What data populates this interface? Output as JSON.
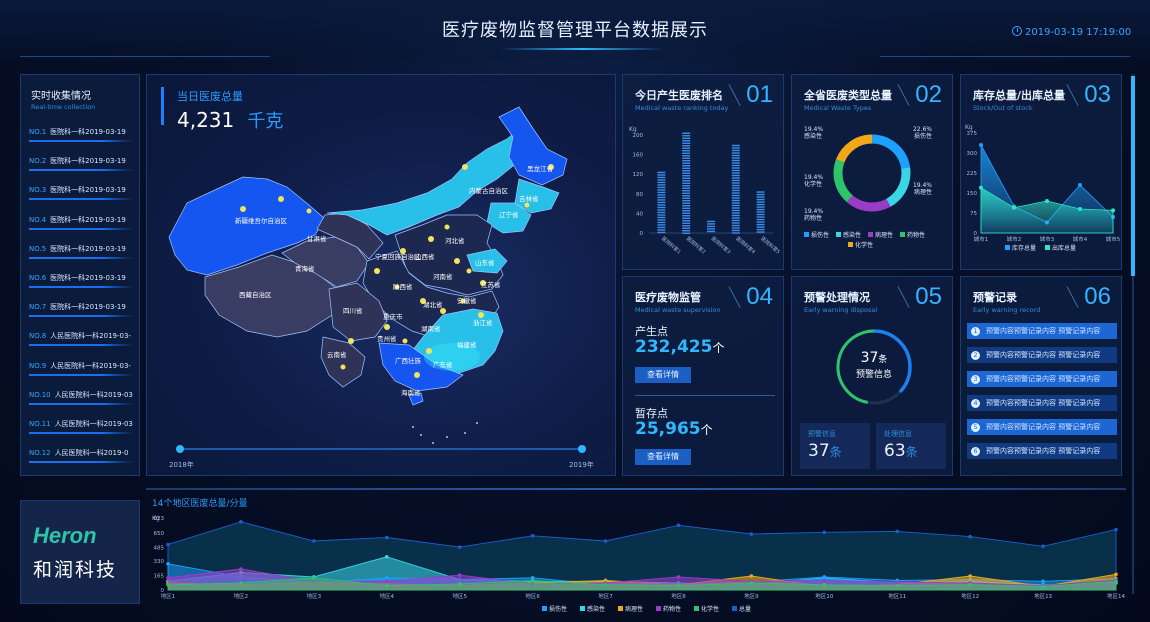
{
  "header": {
    "title": "医疗废物监督管理平台数据展示",
    "datetime": "2019-03-19 17:19:00",
    "clock_icon": "clock-icon"
  },
  "left": {
    "title": "实时收集情况",
    "subtitle": "Real-time collection",
    "items": [
      {
        "no": "NO.1",
        "text": "医院科一科2019-03-19"
      },
      {
        "no": "NO.2",
        "text": "医院科一科2019-03-19"
      },
      {
        "no": "NO.3",
        "text": "医院科一科2019-03-19"
      },
      {
        "no": "NO.4",
        "text": "医院科一科2019-03-19"
      },
      {
        "no": "NO.5",
        "text": "医院科一科2019-03-19"
      },
      {
        "no": "NO.6",
        "text": "医院科一科2019-03-19"
      },
      {
        "no": "NO.7",
        "text": "医院科一科2019-03-19"
      },
      {
        "no": "NO.8",
        "text": "人民医院科一科2019-03-"
      },
      {
        "no": "NO.9",
        "text": "人民医院科一科2019-03-"
      },
      {
        "no": "NO.10",
        "text": "人民医院科一科2019-03"
      },
      {
        "no": "NO.11",
        "text": "人民医院科一科2019-03"
      },
      {
        "no": "NO.12",
        "text": "人民医院科一科2019-0"
      }
    ]
  },
  "map": {
    "title": "当日医废总量",
    "total": "4,231",
    "unit": "千克",
    "timeline_start": "2018年",
    "timeline_end": "2019年",
    "provinces": [
      "黑龙江省",
      "吉林省",
      "辽宁省",
      "内蒙古自治区",
      "新疆维吾尔自治区",
      "甘肃省",
      "青海省",
      "西藏自治区",
      "四川省",
      "云南省",
      "贵州省",
      "广西壮族",
      "广东省",
      "湖南省",
      "湖北省",
      "重庆市",
      "陕西省",
      "宁夏回族自治区",
      "山西省",
      "河北省",
      "山东省",
      "河南省",
      "安徽省",
      "江苏省",
      "浙江省",
      "福建省",
      "海南省"
    ]
  },
  "panels": {
    "p1": {
      "title": "今日产生医废排名",
      "subtitle": "Medical waste ranking today",
      "num": "01"
    },
    "p2": {
      "title": "全省医废类型总量",
      "subtitle": "Medical Waste Types",
      "num": "02"
    },
    "p3": {
      "title": "库存总量/出库总量",
      "subtitle": "Stock/Out of stock",
      "num": "03"
    },
    "p4": {
      "title": "医疗废物监管",
      "subtitle": "Medical waste supervision",
      "num": "04",
      "produce_label": "产生点",
      "produce_value": "232,425",
      "produce_unit": "个",
      "produce_btn": "查看详情",
      "store_label": "暂存点",
      "store_value": "25,965",
      "store_unit": "个",
      "store_btn": "查看详情"
    },
    "p5": {
      "title": "预警处理情况",
      "subtitle": "Early warning disposal",
      "num": "05",
      "ring_value": "37",
      "ring_unit": "条",
      "ring_label": "预警信息",
      "left_label": "预警信息",
      "left_value": "37",
      "left_unit": "条",
      "right_label": "处理信息",
      "right_value": "63",
      "right_unit": "条"
    },
    "p6": {
      "title": "预警记录",
      "subtitle": "Early warning record",
      "num": "06",
      "rows": [
        {
          "n": "1",
          "text": "预警内容预警记录内容 预警记录内容"
        },
        {
          "n": "2",
          "text": "预警内容预警记录内容 预警记录内容"
        },
        {
          "n": "3",
          "text": "预警内容预警记录内容 预警记录内容"
        },
        {
          "n": "4",
          "text": "预警内容预警记录内容 预警记录内容"
        },
        {
          "n": "5",
          "text": "预警内容预警记录内容 预警记录内容"
        },
        {
          "n": "6",
          "text": "预警内容预警记录内容 预警记录内容"
        }
      ]
    }
  },
  "brand": {
    "logo_text": "Heron",
    "name": "和润科技"
  },
  "bottom": {
    "title": "14个地区医废总量/分量"
  },
  "colors": {
    "accent": "#33b5ff",
    "panel": "#0d1e42",
    "border": "#1a3a70"
  },
  "chart_data": [
    {
      "type": "bar",
      "ylabel": "Kg",
      "ylim": [
        0,
        200
      ],
      "yticks": [
        0,
        40,
        80,
        120,
        160,
        200
      ],
      "categories": [
        "医院科室1",
        "医院科室2",
        "医院科室3",
        "医院科室4",
        "医院科室5"
      ],
      "values": [
        125,
        205,
        25,
        180,
        85
      ]
    },
    {
      "type": "pie",
      "style": "donut",
      "labels": [
        "感染性",
        "损伤性",
        "病理性",
        "药物性",
        "化学性"
      ],
      "values": [
        22.6,
        19.4,
        19.4,
        19.4,
        19.4
      ],
      "label_text": [
        "22.6% 损伤性",
        "19.4% 感染性",
        "19.4% 病理性",
        "19.4% 药物性",
        "19.4% 化学性"
      ],
      "legend": [
        "损伤性",
        "感染性",
        "病理性",
        "药物性",
        "化学性"
      ],
      "colors": [
        "#1ea0ff",
        "#3ad6e6",
        "#9a3cc8",
        "#2ec46a",
        "#f0a818"
      ]
    },
    {
      "type": "area",
      "ylabel": "Kg",
      "ylim": [
        0,
        375
      ],
      "yticks": [
        0,
        75,
        150,
        225,
        300,
        375
      ],
      "categories": [
        "城市1",
        "城市2",
        "城市3",
        "城市4",
        "城市5"
      ],
      "series": [
        {
          "name": "库存总量",
          "values": [
            330,
            100,
            40,
            180,
            60
          ]
        },
        {
          "name": "出库总量",
          "values": [
            170,
            95,
            120,
            90,
            85
          ]
        }
      ]
    },
    {
      "type": "area",
      "title": "14个地区医废总量/分量",
      "ylabel": "Kg",
      "ylim": [
        0,
        823
      ],
      "yticks": [
        0,
        165,
        330,
        485,
        650,
        823
      ],
      "categories": [
        "地区1",
        "地区2",
        "地区3",
        "地区4",
        "地区5",
        "地区6",
        "地区7",
        "地区8",
        "地区9",
        "地区10",
        "地区11",
        "地区12",
        "地区13",
        "地区14"
      ],
      "series": [
        {
          "name": "损伤性",
          "values": [
            300,
            150,
            80,
            140,
            120,
            140,
            60,
            70,
            90,
            150,
            110,
            120,
            100,
            130
          ]
        },
        {
          "name": "感染性",
          "values": [
            100,
            200,
            150,
            380,
            120,
            100,
            100,
            80,
            60,
            140,
            80,
            100,
            60,
            80
          ]
        },
        {
          "name": "病理性",
          "values": [
            80,
            60,
            90,
            70,
            50,
            80,
            110,
            60,
            160,
            40,
            60,
            160,
            40,
            180
          ]
        },
        {
          "name": "药物性",
          "values": [
            140,
            240,
            100,
            100,
            170,
            70,
            80,
            150,
            100,
            110,
            90,
            80,
            50,
            110
          ]
        },
        {
          "name": "化学性",
          "values": [
            60,
            80,
            140,
            50,
            70,
            110,
            60,
            50,
            80,
            60,
            50,
            60,
            40,
            100
          ]
        },
        {
          "name": "总量",
          "values": [
            520,
            780,
            560,
            600,
            490,
            620,
            560,
            740,
            640,
            660,
            670,
            610,
            500,
            690
          ]
        }
      ],
      "colors": [
        "#1ea0ff",
        "#3ad6e6",
        "#f0a818",
        "#9a3cc8",
        "#2ec46a",
        "#1a5fd0"
      ]
    }
  ]
}
